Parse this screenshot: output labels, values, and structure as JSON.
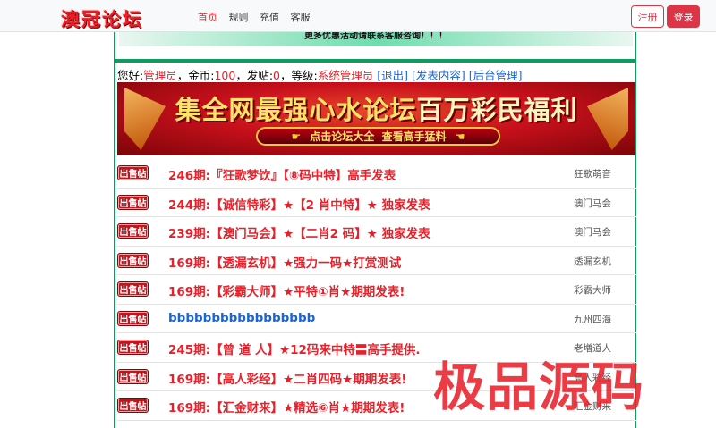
{
  "header": {
    "logo": "澳冠论坛",
    "nav": [
      "首页",
      "规则",
      "充值",
      "客服"
    ],
    "register_label": "注册",
    "login_label": "登录"
  },
  "notice": "更多优惠活动请联系客服咨询！！！",
  "user": {
    "greeting": "您好:",
    "name": "管理员",
    "coins_label": "，金币:",
    "coins": "100",
    "posts_label": "，发贴:",
    "posts": "0",
    "level_label": "，等级:",
    "level": "系统管理员",
    "logout": "[退出]",
    "publish": "[发表内容]",
    "admin": "[后台管理]"
  },
  "banner": {
    "title_a": "集全网最强心水论坛",
    "title_b": "百万彩民福利",
    "sub_a": "点击论坛大全",
    "sub_b": "查看高手猛料"
  },
  "posts": [
    {
      "badge": "出售帖",
      "title": "246期:『狂歌梦饮』【⑧码中特】高手发表",
      "author": "狂歌萌音",
      "color": "#e8202a"
    },
    {
      "badge": "出售帖",
      "title": "244期:【诚信特彩】★【2 肖中特】★ 独家发表",
      "author": "澳门马会",
      "color": "#e8202a"
    },
    {
      "badge": "出售帖",
      "title": "239期:【澳门马会】★【二肖2 码】★ 独家发表",
      "author": "澳门马会",
      "color": "#e8202a"
    },
    {
      "badge": "出售帖",
      "title": "169期:【透漏玄机】★强力一码★打赏测试",
      "author": "透漏玄机",
      "color": "#e8202a"
    },
    {
      "badge": "出售帖",
      "title": "169期:【彩霸大师】★平特①肖★期期发表!",
      "author": "彩霸大师",
      "color": "#e8202a"
    },
    {
      "badge": "出售帖",
      "title": "bbbbbbbbbbbbbbbbb",
      "author": "九州四海",
      "color": "#1a64d6"
    },
    {
      "badge": "出售帖",
      "title": "245期:【曾 道 人】★12码来中特〓高手提供.",
      "author": "老増道人",
      "color": "#e8202a"
    },
    {
      "badge": "出售帖",
      "title": "169期:【高人彩经】★二肖四码★期期发表!",
      "author": "高人彩经",
      "color": "#e8202a"
    },
    {
      "badge": "出售帖",
      "title": "169期:【汇金财来】★精选⑥肖★期期发表!",
      "author": "汇金财来",
      "color": "#e8202a"
    }
  ],
  "watermark": "极品源码"
}
